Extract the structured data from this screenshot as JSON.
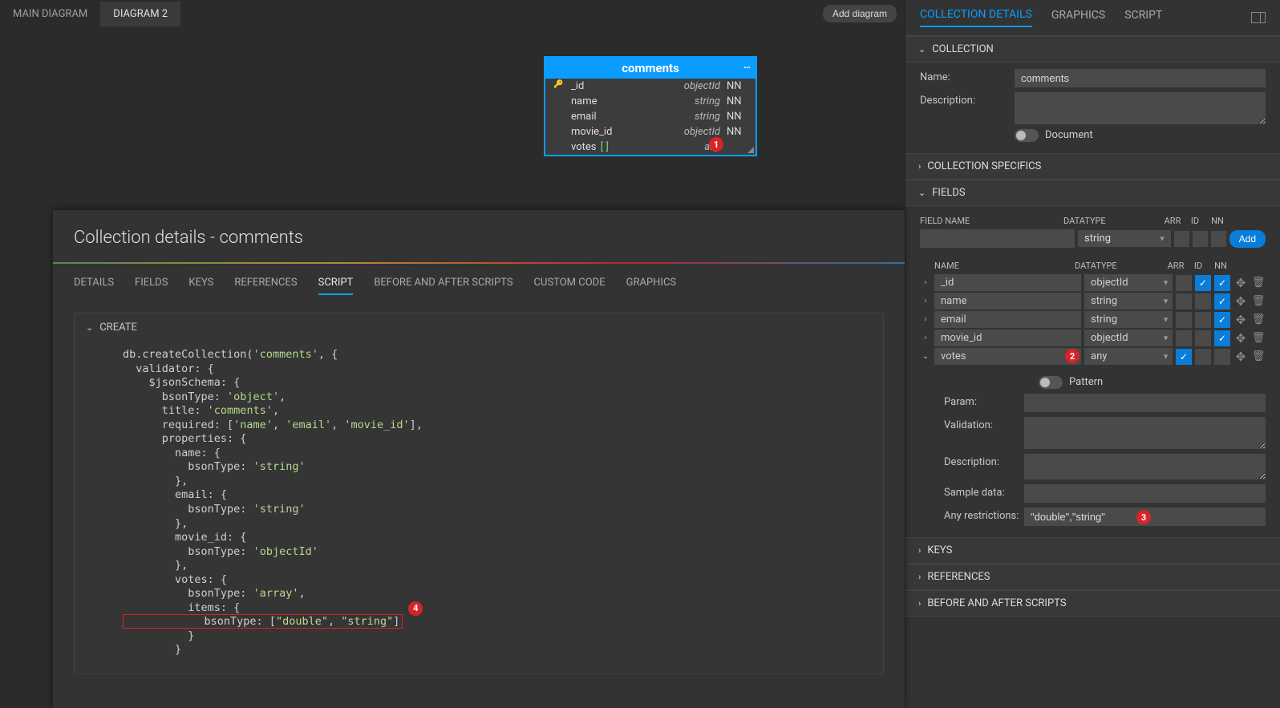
{
  "top_tabs": {
    "main": "MAIN DIAGRAM",
    "diagram2": "DIAGRAM 2",
    "add": "Add diagram"
  },
  "canvas_collection": {
    "title": "comments",
    "rows": [
      {
        "name": "_id",
        "type": "objectId",
        "nn": "NN",
        "key": true
      },
      {
        "name": "name",
        "type": "string",
        "nn": "NN"
      },
      {
        "name": "email",
        "type": "string",
        "nn": "NN"
      },
      {
        "name": "movie_id",
        "type": "objectId",
        "nn": "NN"
      },
      {
        "name": "votes",
        "type": "any",
        "nn": "",
        "array": true
      }
    ],
    "badge": "1"
  },
  "detail_panel": {
    "title": "Collection details - comments",
    "tabs": [
      "DETAILS",
      "FIELDS",
      "KEYS",
      "REFERENCES",
      "SCRIPT",
      "BEFORE AND AFTER SCRIPTS",
      "CUSTOM CODE",
      "GRAPHICS"
    ],
    "active_tab": "SCRIPT",
    "create_label": "CREATE",
    "code": {
      "l1a": "db.createCollection(",
      "l1b": "'comments'",
      "l1c": ", {",
      "l2": "  validator: {",
      "l3": "    $jsonSchema: {",
      "l4a": "      bsonType: ",
      "l4b": "'object'",
      "l4c": ",",
      "l5a": "      title: ",
      "l5b": "'comments'",
      "l5c": ",",
      "l6a": "      required: [",
      "l6b": "'name'",
      "l6c": ", ",
      "l6d": "'email'",
      "l6e": ", ",
      "l6f": "'movie_id'",
      "l6g": "],",
      "l7": "      properties: {",
      "l8": "        name: {",
      "l9a": "          bsonType: ",
      "l9b": "'string'",
      "l10": "        },",
      "l11": "        email: {",
      "l12a": "          bsonType: ",
      "l12b": "'string'",
      "l13": "        },",
      "l14": "        movie_id: {",
      "l15a": "          bsonType: ",
      "l15b": "'objectId'",
      "l16": "        },",
      "l17": "        votes: {",
      "l18a": "          bsonType: ",
      "l18b": "'array'",
      "l18c": ",",
      "l19": "          items: {",
      "l20a": "            bsonType: [",
      "l20b": "\"double\"",
      "l20c": ", ",
      "l20d": "\"string\"",
      "l20e": "]",
      "l21": "          }",
      "l22": "        }",
      "badge4": "4"
    }
  },
  "rp": {
    "tabs": {
      "collection": "COLLECTION DETAILS",
      "graphics": "GRAPHICS",
      "script": "SCRIPT"
    },
    "sec_collection": "COLLECTION",
    "labels": {
      "name": "Name:",
      "description": "Description:",
      "document": "Document"
    },
    "name_value": "comments",
    "sec_specifics": "COLLECTION SPECIFICS",
    "sec_fields": "FIELDS",
    "add_head": {
      "name": "FIELD NAME",
      "type": "DATATYPE",
      "arr": "ARR",
      "id": "ID",
      "nn": "NN"
    },
    "default_type": "string",
    "add_btn": "Add",
    "list_head": {
      "name": "NAME",
      "type": "DATATYPE",
      "arr": "ARR",
      "id": "ID",
      "nn": "NN"
    },
    "fields": [
      {
        "name": "_id",
        "type": "objectId",
        "arr": false,
        "id": true,
        "nn": true,
        "caret": ">"
      },
      {
        "name": "name",
        "type": "string",
        "arr": false,
        "id": false,
        "nn": true,
        "caret": ">"
      },
      {
        "name": "email",
        "type": "string",
        "arr": false,
        "id": false,
        "nn": true,
        "caret": ">"
      },
      {
        "name": "movie_id",
        "type": "objectId",
        "arr": false,
        "id": false,
        "nn": true,
        "caret": ">"
      },
      {
        "name": "votes",
        "type": "any",
        "arr": true,
        "id": false,
        "nn": false,
        "caret": "v"
      }
    ],
    "badge2": "2",
    "pattern_label": "Pattern",
    "details": {
      "param": "Param:",
      "validation": "Validation:",
      "description": "Description:",
      "sample": "Sample data:",
      "restrictions": "Any restrictions:",
      "restrictions_value": "\"double\",\"string\"",
      "badge3": "3"
    },
    "sec_keys": "KEYS",
    "sec_refs": "REFERENCES",
    "sec_ba": "BEFORE AND AFTER SCRIPTS"
  }
}
